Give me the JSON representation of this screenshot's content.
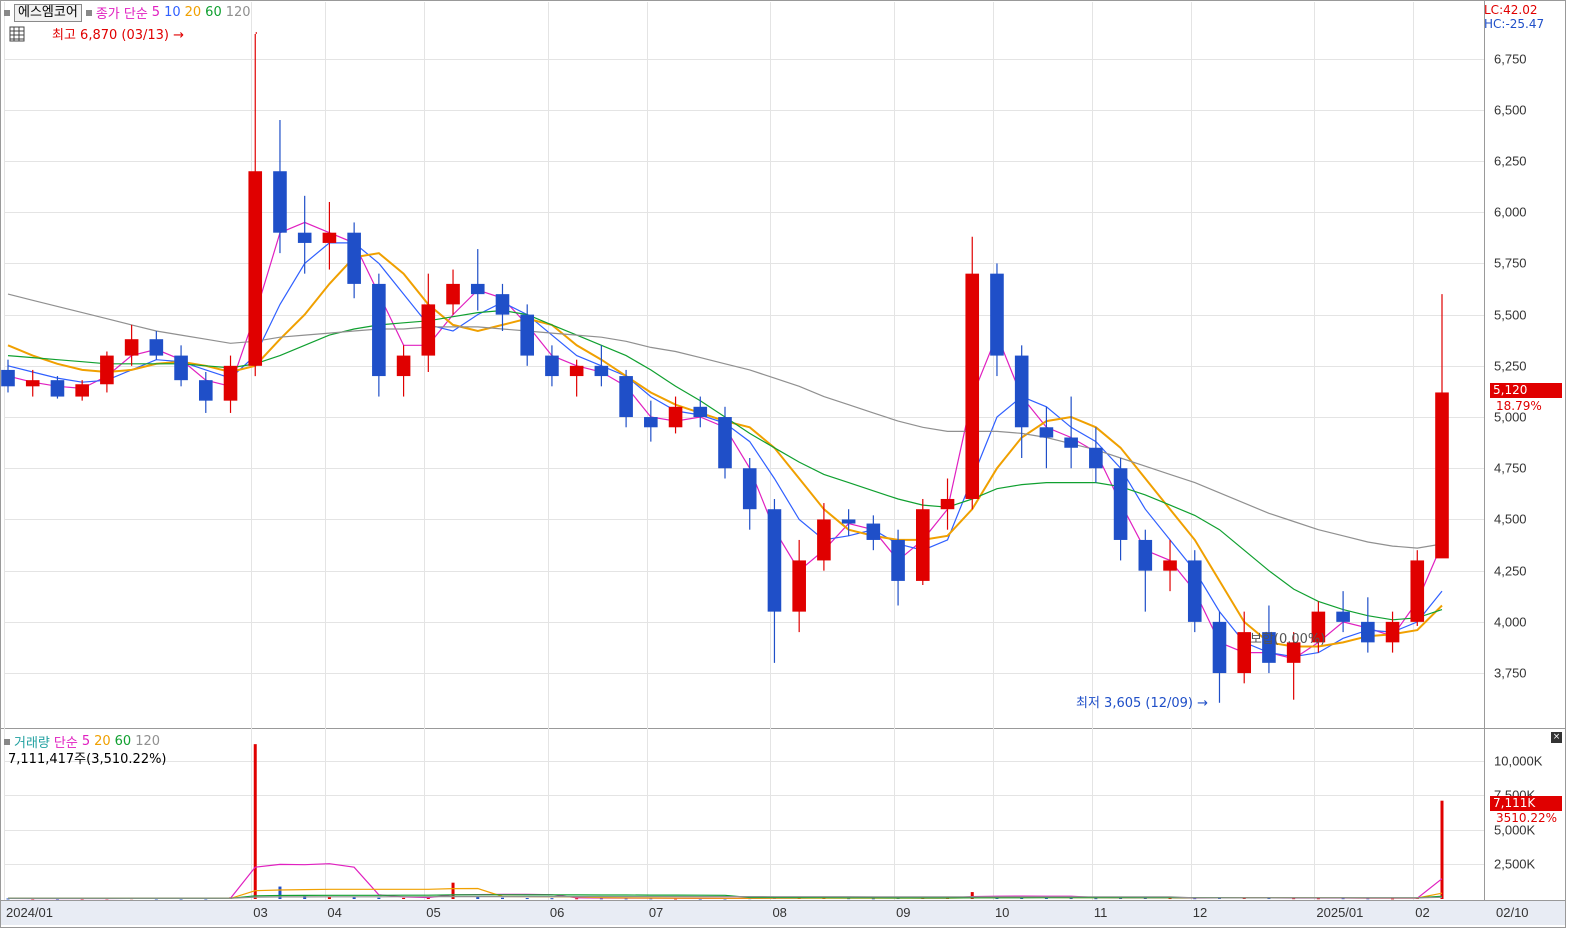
{
  "stock_name": "에스엠코어",
  "price_legend": {
    "label": "종가 단순",
    "periods": [
      "5",
      "10",
      "20",
      "60",
      "120"
    ]
  },
  "volume_legend": {
    "label": "거래량",
    "ma_label": "단순",
    "periods": [
      "5",
      "20",
      "60",
      "120"
    ],
    "summary": "7,111,417주(3,510.22%)"
  },
  "top_right": {
    "lc": "LC:42.02",
    "hc": "HC:-25.47"
  },
  "annotations": {
    "high": "최고 6,870 (03/13)",
    "low": "최저 3,605 (12/09)",
    "flat": "보합(0.00%)"
  },
  "price_badge": {
    "value": "5,120",
    "pct": "18.79%"
  },
  "volume_badge": {
    "value": "7,111K",
    "pct": "3510.22%"
  },
  "colors": {
    "up": "#e00000",
    "down": "#1f4fc8",
    "ma5": "#e020c0",
    "ma10": "#3060ff",
    "ma20": "#f0a000",
    "ma60": "#10a030",
    "ma120": "#909090"
  },
  "icons": [
    "grid-table-icon",
    "collapse-icon"
  ],
  "chart_data": [
    {
      "type": "candlestick",
      "title": "",
      "ylim": [
        3500,
        6870
      ],
      "yticks": [
        "6,750",
        "6,500",
        "6,250",
        "6,000",
        "5,750",
        "5,500",
        "5,250",
        "5,000",
        "4,750",
        "4,500",
        "4,250",
        "4,000",
        "3,750"
      ],
      "xticks": [
        "2024/01",
        "03",
        "04",
        "05",
        "06",
        "07",
        "08",
        "09",
        "10",
        "11",
        "12",
        "2025/01",
        "02",
        "02/10"
      ],
      "grid": true,
      "candles": [
        [
          "2024-01-02",
          5230,
          5280,
          5120,
          5150
        ],
        [
          "2024-01-08",
          5150,
          5230,
          5100,
          5180
        ],
        [
          "2024-01-15",
          5180,
          5200,
          5090,
          5100
        ],
        [
          "2024-01-22",
          5100,
          5180,
          5080,
          5160
        ],
        [
          "2024-01-29",
          5160,
          5320,
          5120,
          5300
        ],
        [
          "2024-02-05",
          5300,
          5450,
          5250,
          5380
        ],
        [
          "2024-02-13",
          5380,
          5420,
          5280,
          5300
        ],
        [
          "2024-02-19",
          5300,
          5350,
          5150,
          5180
        ],
        [
          "2024-02-26",
          5180,
          5220,
          5020,
          5080
        ],
        [
          "2024-03-04",
          5080,
          5300,
          5020,
          5250
        ],
        [
          "2024-03-11",
          5250,
          6870,
          5200,
          6200
        ],
        [
          "2024-03-18",
          6200,
          6450,
          5800,
          5900
        ],
        [
          "2024-03-25",
          5900,
          6080,
          5700,
          5850
        ],
        [
          "2024-04-01",
          5850,
          6050,
          5720,
          5900
        ],
        [
          "2024-04-08",
          5900,
          5950,
          5580,
          5650
        ],
        [
          "2024-04-15",
          5650,
          5700,
          5100,
          5200
        ],
        [
          "2024-04-22",
          5200,
          5350,
          5100,
          5300
        ],
        [
          "2024-04-29",
          5300,
          5700,
          5220,
          5550
        ],
        [
          "2024-05-07",
          5550,
          5720,
          5500,
          5650
        ],
        [
          "2024-05-13",
          5650,
          5820,
          5520,
          5600
        ],
        [
          "2024-05-20",
          5600,
          5650,
          5420,
          5500
        ],
        [
          "2024-05-27",
          5500,
          5550,
          5250,
          5300
        ],
        [
          "2024-06-03",
          5300,
          5350,
          5150,
          5200
        ],
        [
          "2024-06-10",
          5200,
          5280,
          5100,
          5250
        ],
        [
          "2024-06-17",
          5250,
          5350,
          5150,
          5200
        ],
        [
          "2024-06-24",
          5200,
          5230,
          4950,
          5000
        ],
        [
          "2024-07-01",
          5000,
          5080,
          4880,
          4950
        ],
        [
          "2024-07-08",
          4950,
          5100,
          4920,
          5050
        ],
        [
          "2024-07-15",
          5050,
          5100,
          4950,
          5000
        ],
        [
          "2024-07-22",
          5000,
          5050,
          4700,
          4750
        ],
        [
          "2024-07-29",
          4750,
          4800,
          4450,
          4550
        ],
        [
          "2024-08-05",
          4550,
          4600,
          3800,
          4050
        ],
        [
          "2024-08-12",
          4050,
          4400,
          3950,
          4300
        ],
        [
          "2024-08-19",
          4300,
          4580,
          4250,
          4500
        ],
        [
          "2024-08-26",
          4500,
          4550,
          4420,
          4480
        ],
        [
          "2024-09-02",
          4480,
          4520,
          4350,
          4400
        ],
        [
          "2024-09-09",
          4400,
          4450,
          4080,
          4200
        ],
        [
          "2024-09-19",
          4200,
          4600,
          4180,
          4550
        ],
        [
          "2024-09-23",
          4550,
          4700,
          4450,
          4600
        ],
        [
          "2024-09-30",
          4600,
          5880,
          4550,
          5700
        ],
        [
          "2024-10-07",
          5700,
          5750,
          5200,
          5300
        ],
        [
          "2024-10-14",
          5300,
          5350,
          4800,
          4950
        ],
        [
          "2024-10-21",
          4950,
          5050,
          4750,
          4900
        ],
        [
          "2024-10-28",
          4900,
          5100,
          4750,
          4850
        ],
        [
          "2024-11-04",
          4850,
          4950,
          4680,
          4750
        ],
        [
          "2024-11-11",
          4750,
          4800,
          4300,
          4400
        ],
        [
          "2024-11-18",
          4400,
          4450,
          4050,
          4250
        ],
        [
          "2024-11-25",
          4250,
          4400,
          4150,
          4300
        ],
        [
          "2024-12-02",
          4300,
          4350,
          3950,
          4000
        ],
        [
          "2024-12-09",
          4000,
          4050,
          3605,
          3750
        ],
        [
          "2024-12-16",
          3750,
          4050,
          3700,
          3950
        ],
        [
          "2024-12-23",
          3950,
          4080,
          3750,
          3800
        ],
        [
          "2024-12-30",
          3800,
          3950,
          3620,
          3900
        ],
        [
          "2025-01-06",
          3900,
          4100,
          3850,
          4050
        ],
        [
          "2025-01-13",
          4050,
          4150,
          3950,
          4000
        ],
        [
          "2025-01-20",
          4000,
          4120,
          3850,
          3900
        ],
        [
          "2025-01-31",
          3900,
          4050,
          3850,
          4000
        ],
        [
          "2025-02-03",
          4000,
          4350,
          3980,
          4300
        ],
        [
          "2025-02-10",
          4310,
          5600,
          4820,
          5120
        ]
      ],
      "ma": {
        "ma5": [
          5200,
          5170,
          5150,
          5140,
          5200,
          5300,
          5330,
          5280,
          5180,
          5150,
          5500,
          5900,
          5950,
          5900,
          5850,
          5600,
          5350,
          5350,
          5500,
          5620,
          5580,
          5450,
          5300,
          5250,
          5220,
          5150,
          5000,
          4980,
          5000,
          4950,
          4750,
          4450,
          4250,
          4350,
          4480,
          4450,
          4300,
          4400,
          4550,
          5100,
          5400,
          5100,
          4950,
          4900,
          4830,
          4580,
          4350,
          4300,
          4150,
          3900,
          3850,
          3850,
          3820,
          3900,
          4000,
          3970,
          3930,
          4100,
          4380
        ],
        "ma10": [
          5250,
          5220,
          5190,
          5170,
          5180,
          5230,
          5280,
          5270,
          5230,
          5190,
          5300,
          5550,
          5750,
          5850,
          5850,
          5750,
          5600,
          5450,
          5420,
          5500,
          5560,
          5500,
          5400,
          5300,
          5250,
          5200,
          5100,
          5030,
          5010,
          4970,
          4880,
          4700,
          4500,
          4400,
          4420,
          4450,
          4380,
          4350,
          4400,
          4700,
          5000,
          5100,
          5050,
          4950,
          4880,
          4750,
          4550,
          4400,
          4250,
          4050,
          3900,
          3850,
          3830,
          3850,
          3920,
          3960,
          3950,
          4000,
          4150
        ],
        "ma20": [
          5350,
          5300,
          5260,
          5230,
          5220,
          5230,
          5260,
          5270,
          5250,
          5220,
          5250,
          5380,
          5500,
          5650,
          5780,
          5800,
          5700,
          5550,
          5450,
          5420,
          5450,
          5480,
          5450,
          5350,
          5280,
          5200,
          5120,
          5060,
          5020,
          4980,
          4950,
          4850,
          4700,
          4550,
          4450,
          4420,
          4400,
          4400,
          4420,
          4550,
          4750,
          4900,
          4980,
          5000,
          4950,
          4850,
          4700,
          4550,
          4400,
          4200,
          4000,
          3900,
          3880,
          3880,
          3900,
          3930,
          3940,
          3960,
          4080
        ],
        "ma60": [
          5300,
          5290,
          5280,
          5270,
          5260,
          5260,
          5260,
          5260,
          5250,
          5240,
          5260,
          5300,
          5350,
          5400,
          5430,
          5450,
          5460,
          5470,
          5490,
          5510,
          5520,
          5500,
          5450,
          5400,
          5350,
          5300,
          5230,
          5150,
          5080,
          5000,
          4920,
          4850,
          4780,
          4720,
          4680,
          4640,
          4600,
          4570,
          4560,
          4600,
          4650,
          4670,
          4680,
          4680,
          4680,
          4660,
          4620,
          4570,
          4520,
          4450,
          4350,
          4250,
          4160,
          4100,
          4060,
          4030,
          4010,
          4020,
          4060
        ],
        "ma120": [
          5600,
          5570,
          5540,
          5510,
          5480,
          5450,
          5420,
          5400,
          5380,
          5360,
          5370,
          5390,
          5400,
          5410,
          5420,
          5430,
          5430,
          5440,
          5440,
          5440,
          5430,
          5420,
          5410,
          5400,
          5390,
          5370,
          5340,
          5320,
          5290,
          5260,
          5230,
          5190,
          5150,
          5100,
          5060,
          5020,
          4980,
          4950,
          4930,
          4930,
          4930,
          4920,
          4900,
          4870,
          4840,
          4800,
          4760,
          4720,
          4680,
          4630,
          4580,
          4530,
          4490,
          4450,
          4420,
          4390,
          4370,
          4360,
          4380
        ]
      },
      "last_close": 5120,
      "high_marker": {
        "date": "03/13",
        "value": 6870
      },
      "low_marker": {
        "date": "12/09",
        "value": 3605
      }
    },
    {
      "type": "bar",
      "title": "",
      "ylim": [
        0,
        11500
      ],
      "unit": "K",
      "yticks": [
        "10,000K",
        "7,500K",
        "5,000K",
        "2,500K"
      ],
      "volume": [
        40,
        35,
        30,
        35,
        45,
        60,
        40,
        35,
        40,
        120,
        11200,
        900,
        220,
        150,
        120,
        90,
        80,
        110,
        1180,
        160,
        90,
        70,
        60,
        55,
        50,
        45,
        50,
        40,
        35,
        40,
        60,
        150,
        110,
        80,
        60,
        50,
        70,
        90,
        120,
        500,
        180,
        120,
        90,
        70,
        60,
        80,
        90,
        70,
        60,
        120,
        80,
        70,
        60,
        55,
        60,
        50,
        45,
        90,
        7111
      ],
      "vol_ma5": [
        40,
        38,
        36,
        35,
        37,
        45,
        50,
        45,
        40,
        50,
        2300,
        2500,
        2480,
        2550,
        2300,
        300,
        150,
        110,
        300,
        320,
        330,
        330,
        310,
        90,
        70,
        58,
        55,
        50,
        45,
        42,
        43,
        62,
        75,
        85,
        90,
        100,
        85,
        70,
        75,
        170,
        200,
        210,
        200,
        200,
        110,
        90,
        85,
        80,
        75,
        80,
        86,
        80,
        75,
        73,
        70,
        60,
        56,
        60,
        1470
      ],
      "vol_ma20": [
        40,
        40,
        40,
        40,
        40,
        40,
        40,
        40,
        40,
        45,
        600,
        650,
        680,
        700,
        700,
        700,
        700,
        700,
        750,
        760,
        180,
        170,
        160,
        150,
        100,
        80,
        70,
        60,
        55,
        50,
        50,
        55,
        60,
        62,
        60,
        58,
        58,
        60,
        65,
        90,
        100,
        105,
        105,
        100,
        98,
        98,
        95,
        90,
        90,
        90,
        88,
        86,
        84,
        80,
        78,
        75,
        72,
        73,
        420
      ],
      "vol_ma60": [
        45,
        45,
        45,
        45,
        45,
        45,
        45,
        45,
        45,
        48,
        230,
        250,
        260,
        265,
        268,
        270,
        272,
        275,
        300,
        302,
        302,
        300,
        298,
        296,
        292,
        290,
        285,
        280,
        276,
        270,
        110,
        105,
        100,
        95,
        90,
        85,
        82,
        80,
        80,
        85,
        88,
        90,
        92,
        92,
        93,
        93,
        93,
        93,
        92,
        92,
        90,
        88,
        86,
        85,
        84,
        82,
        80,
        80,
        200
      ],
      "vol_ma120": [
        50,
        50,
        50,
        50,
        50,
        50,
        50,
        50,
        50,
        52,
        140,
        150,
        155,
        158,
        160,
        162,
        163,
        165,
        175,
        176,
        176,
        176,
        176,
        176,
        175,
        175,
        174,
        173,
        172,
        171,
        170,
        168,
        166,
        165,
        163,
        162,
        160,
        158,
        157,
        158,
        160,
        160,
        160,
        159,
        158,
        156,
        155,
        153,
        80,
        80,
        79,
        78,
        78,
        77,
        77,
        76,
        76,
        76,
        120
      ]
    }
  ]
}
